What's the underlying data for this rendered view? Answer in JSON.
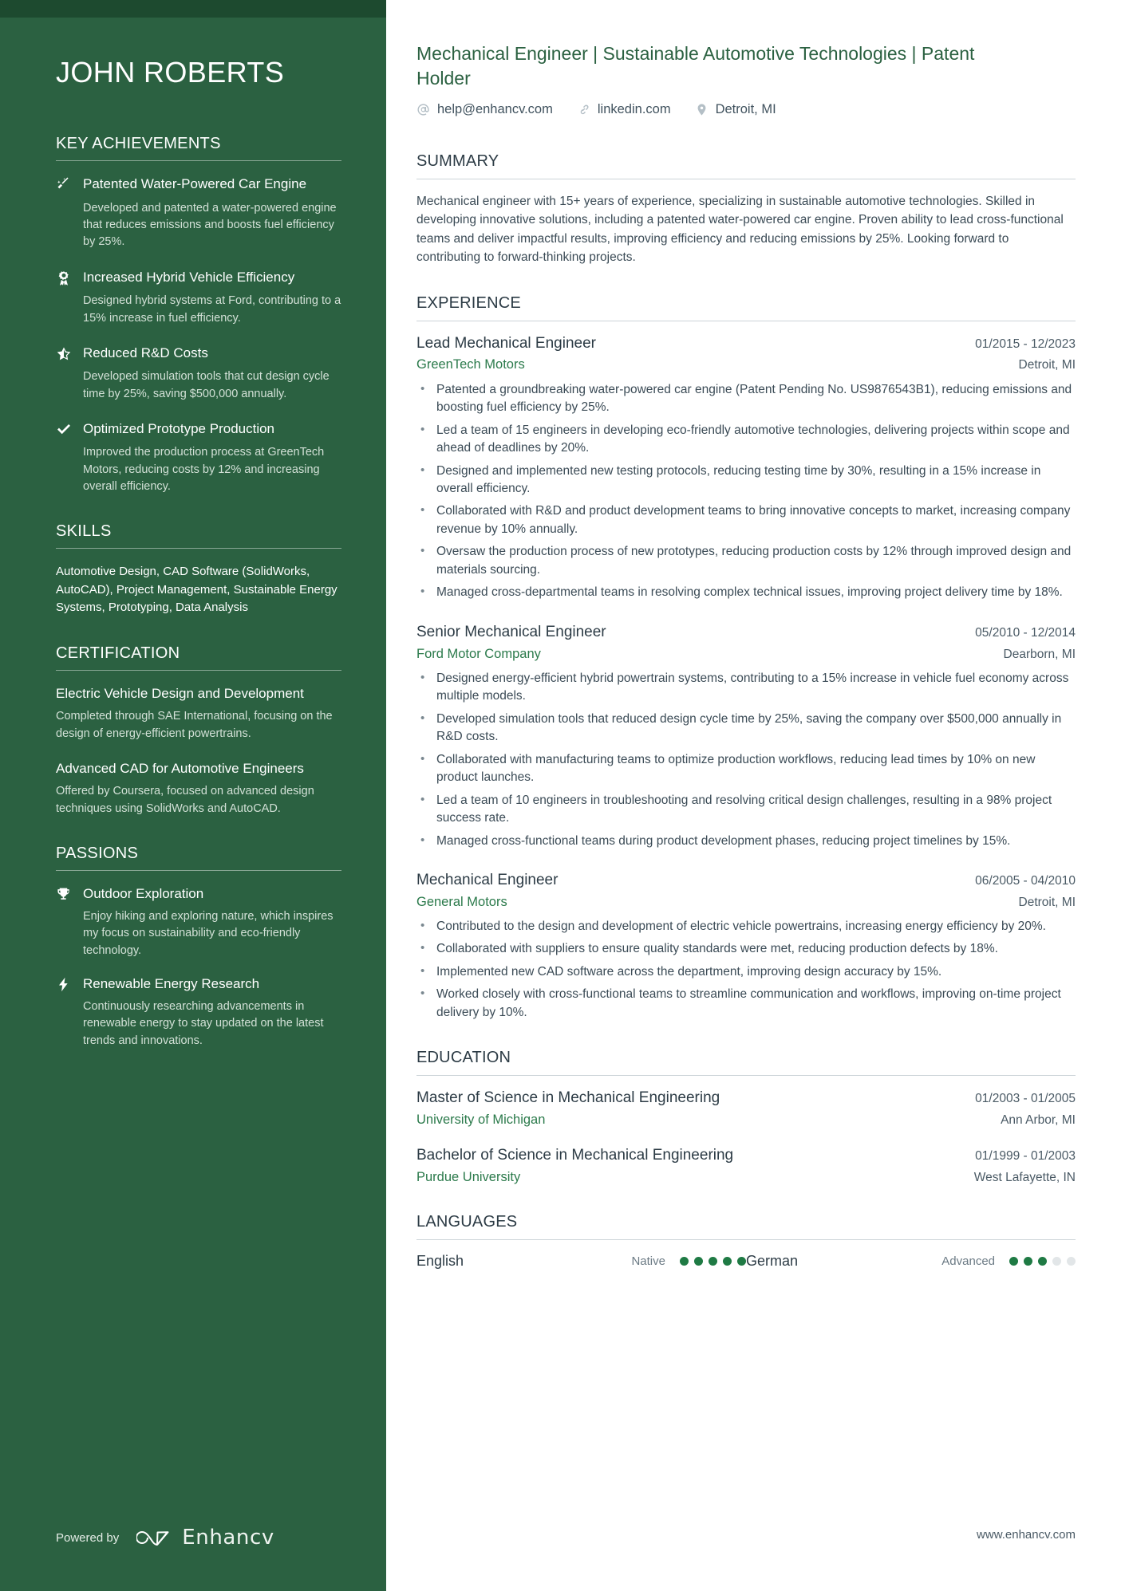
{
  "theme": {
    "sidebar_bg": "#2b6141",
    "sidebar_top_strip": "#1d4a2f",
    "accent_green": "#2b7a4b",
    "headline_green": "#2b6141",
    "body_text": "#3b4b56"
  },
  "sidebar": {
    "name": "JOHN ROBERTS",
    "sections": {
      "achievements_heading": "KEY ACHIEVEMENTS",
      "achievements": [
        {
          "icon": "magic-wand-icon",
          "title": "Patented Water-Powered Car Engine",
          "description": "Developed and patented a water-powered engine that reduces emissions and boosts fuel efficiency by 25%."
        },
        {
          "icon": "award-medal-icon",
          "title": "Increased Hybrid Vehicle Efficiency",
          "description": "Designed hybrid systems at Ford, contributing to a 15% increase in fuel efficiency."
        },
        {
          "icon": "half-star-icon",
          "title": "Reduced R&D Costs",
          "description": "Developed simulation tools that cut design cycle time by 25%, saving $500,000 annually."
        },
        {
          "icon": "checkmark-icon",
          "title": "Optimized Prototype Production",
          "description": "Improved the production process at GreenTech Motors, reducing costs by 12% and increasing overall efficiency."
        }
      ],
      "skills_heading": "SKILLS",
      "skills_text": "Automotive Design, CAD Software (SolidWorks, AutoCAD), Project Management, Sustainable Energy Systems, Prototyping, Data Analysis",
      "certification_heading": "CERTIFICATION",
      "certifications": [
        {
          "title": "Electric Vehicle Design and Development",
          "description": "Completed through SAE International, focusing on the design of energy-efficient powertrains."
        },
        {
          "title": "Advanced CAD for Automotive Engineers",
          "description": "Offered by Coursera, focused on advanced design techniques using SolidWorks and AutoCAD."
        }
      ],
      "passions_heading": "PASSIONS",
      "passions": [
        {
          "icon": "trophy-icon",
          "title": "Outdoor Exploration",
          "description": "Enjoy hiking and exploring nature, which inspires my focus on sustainability and eco-friendly technology."
        },
        {
          "icon": "lightning-bolt-icon",
          "title": "Renewable Energy Research",
          "description": "Continuously researching advancements in renewable energy to stay updated on the latest trends and innovations."
        }
      ]
    },
    "footer": {
      "powered_by": "Powered by",
      "brand": "Enhancv"
    }
  },
  "main": {
    "headline": "Mechanical Engineer | Sustainable Automotive Technologies | Patent Holder",
    "contacts": [
      {
        "icon": "at-sign-icon",
        "value": "help@enhancv.com"
      },
      {
        "icon": "link-chain-icon",
        "value": "linkedin.com"
      },
      {
        "icon": "map-pin-icon",
        "value": "Detroit, MI"
      }
    ],
    "summary": {
      "heading": "SUMMARY",
      "text": "Mechanical engineer with 15+ years of experience, specializing in sustainable automotive technologies. Skilled in developing innovative solutions, including a patented water-powered car engine. Proven ability to lead cross-functional teams and deliver impactful results, improving efficiency and reducing emissions by 25%. Looking forward to contributing to forward-thinking projects."
    },
    "experience": {
      "heading": "EXPERIENCE",
      "entries": [
        {
          "title": "Lead Mechanical Engineer",
          "date": "01/2015 - 12/2023",
          "organization": "GreenTech Motors",
          "location": "Detroit, MI",
          "bullets": [
            "Patented a groundbreaking water-powered car engine (Patent Pending No. US9876543B1), reducing emissions and boosting fuel efficiency by 25%.",
            "Led a team of 15 engineers in developing eco-friendly automotive technologies, delivering projects within scope and ahead of deadlines by 20%.",
            "Designed and implemented new testing protocols, reducing testing time by 30%, resulting in a 15% increase in overall efficiency.",
            "Collaborated with R&D and product development teams to bring innovative concepts to market, increasing company revenue by 10% annually.",
            "Oversaw the production process of new prototypes, reducing production costs by 12% through improved design and materials sourcing.",
            "Managed cross-departmental teams in resolving complex technical issues, improving project delivery time by 18%."
          ]
        },
        {
          "title": "Senior Mechanical Engineer",
          "date": "05/2010 - 12/2014",
          "organization": "Ford Motor Company",
          "location": "Dearborn, MI",
          "bullets": [
            "Designed energy-efficient hybrid powertrain systems, contributing to a 15% increase in vehicle fuel economy across multiple models.",
            "Developed simulation tools that reduced design cycle time by 25%, saving the company over $500,000 annually in R&D costs.",
            "Collaborated with manufacturing teams to optimize production workflows, reducing lead times by 10% on new product launches.",
            "Led a team of 10 engineers in troubleshooting and resolving critical design challenges, resulting in a 98% project success rate.",
            "Managed cross-functional teams during product development phases, reducing project timelines by 15%."
          ]
        },
        {
          "title": "Mechanical Engineer",
          "date": "06/2005 - 04/2010",
          "organization": "General Motors",
          "location": "Detroit, MI",
          "bullets": [
            "Contributed to the design and development of electric vehicle powertrains, increasing energy efficiency by 20%.",
            "Collaborated with suppliers to ensure quality standards were met, reducing production defects by 18%.",
            "Implemented new CAD software across the department, improving design accuracy by 15%.",
            "Worked closely with cross-functional teams to streamline communication and workflows, improving on-time project delivery by 10%."
          ]
        }
      ]
    },
    "education": {
      "heading": "EDUCATION",
      "entries": [
        {
          "degree": "Master of Science in Mechanical Engineering",
          "date": "01/2003 - 01/2005",
          "school": "University of Michigan",
          "location": "Ann Arbor, MI"
        },
        {
          "degree": "Bachelor of Science in Mechanical Engineering",
          "date": "01/1999 - 01/2003",
          "school": "Purdue University",
          "location": "West Lafayette, IN"
        }
      ]
    },
    "languages": {
      "heading": "LANGUAGES",
      "items": [
        {
          "name": "English",
          "level": "Native",
          "filled": 5,
          "total": 5
        },
        {
          "name": "German",
          "level": "Advanced",
          "filled": 3,
          "total": 5
        }
      ]
    },
    "footer_url": "www.enhancv.com"
  }
}
